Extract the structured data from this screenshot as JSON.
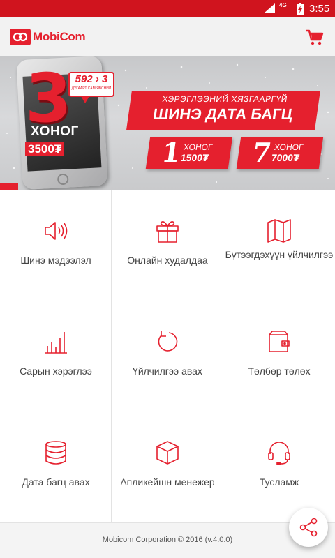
{
  "status_bar": {
    "network": "4G",
    "time": "3:55"
  },
  "app_bar": {
    "logo_text": "MobiCom",
    "cart_icon": "cart-icon"
  },
  "banner": {
    "big_number": "3",
    "days_word": "ХОНОГ",
    "days_price": "3500₮",
    "bubble_main": "592 › 3",
    "bubble_sub": "ДУГААРТ  САМ ЯВСНИЙ",
    "headline_top": "ХЭРЭГЛЭЭНИЙ ХЯЗГААРГҮЙ",
    "headline_main": "ШИНЭ ДАТА БАГЦ",
    "packages": [
      {
        "number": "1",
        "word": "ХОНОГ",
        "price": "1500₮"
      },
      {
        "number": "7",
        "word": "ХОНОГ",
        "price": "7000₮"
      }
    ]
  },
  "menu": [
    {
      "label": "Шинэ мэдээлэл",
      "icon": "speaker-icon"
    },
    {
      "label": "Онлайн худалдаа",
      "icon": "gift-icon"
    },
    {
      "label": "Бүтээгдэхүүн үйлчилгээ",
      "icon": "map-icon"
    },
    {
      "label": "Сарын хэрэглээ",
      "icon": "bar-chart-icon"
    },
    {
      "label": "Үйлчилгээ авах",
      "icon": "refresh-icon"
    },
    {
      "label": "Төлбөр төлөх",
      "icon": "wallet-icon"
    },
    {
      "label": "Дата багц авах",
      "icon": "database-icon"
    },
    {
      "label": "Апликейшн менежер",
      "icon": "cube-icon"
    },
    {
      "label": "Тусламж",
      "icon": "headset-icon"
    }
  ],
  "footer": {
    "text": "Mobicom Corporation © 2016 (v.4.0.0)"
  },
  "fab": {
    "icon": "share-icon"
  },
  "colors": {
    "brand": "#e5202e",
    "status_bar": "#d0141e",
    "icon_stroke": "#e5202e"
  }
}
